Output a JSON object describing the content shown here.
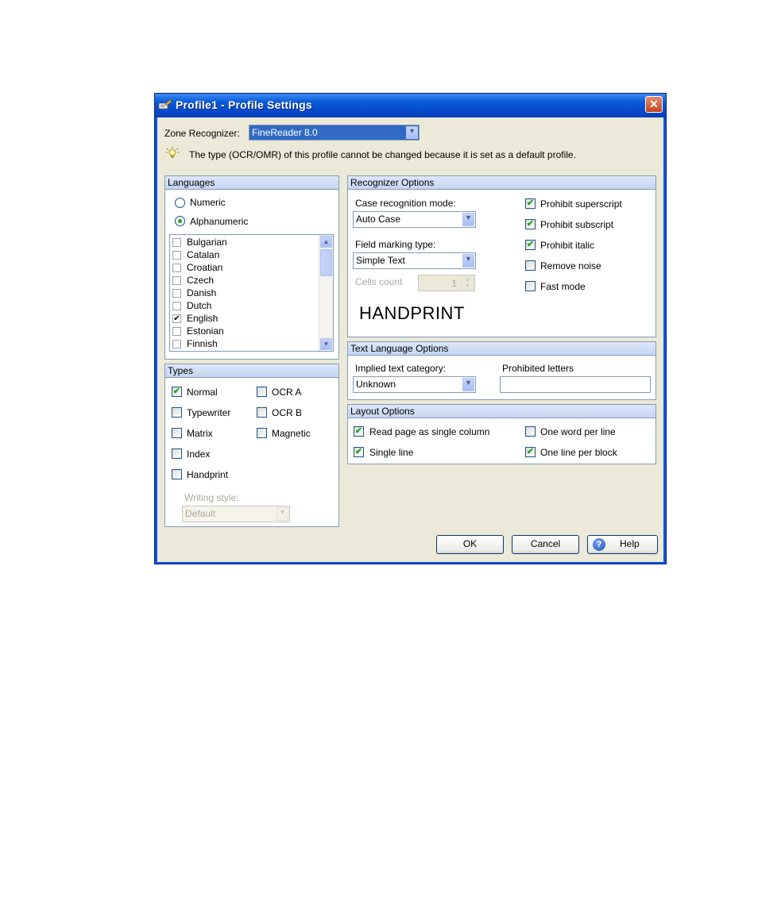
{
  "window": {
    "title": "Profile1 - Profile Settings"
  },
  "zone_recognizer": {
    "label": "Zone Recognizer:",
    "value": "FineReader 8.0"
  },
  "info_message": "The type (OCR/OMR) of this profile cannot be changed because it is set as a default profile.",
  "languages": {
    "header": "Languages",
    "numeric": "Numeric",
    "alphanumeric": "Alphanumeric",
    "items": [
      {
        "label": "Bulgarian",
        "checked": false
      },
      {
        "label": "Catalan",
        "checked": false
      },
      {
        "label": "Croatian",
        "checked": false
      },
      {
        "label": "Czech",
        "checked": false
      },
      {
        "label": "Danish",
        "checked": false
      },
      {
        "label": "Dutch",
        "checked": false
      },
      {
        "label": "English",
        "checked": true
      },
      {
        "label": "Estonian",
        "checked": false
      },
      {
        "label": "Finnish",
        "checked": false
      }
    ]
  },
  "types": {
    "header": "Types",
    "normal": "Normal",
    "typewriter": "Typewriter",
    "matrix": "Matrix",
    "index": "Index",
    "handprint": "Handprint",
    "ocr_a": "OCR A",
    "ocr_b": "OCR B",
    "magnetic": "Magnetic",
    "writing_style_label": "Writing style:",
    "writing_style_value": "Default"
  },
  "recognizer": {
    "header": "Recognizer Options",
    "case_mode_label": "Case recognition mode:",
    "case_mode_value": "Auto Case",
    "field_marking_label": "Field marking type:",
    "field_marking_value": "Simple Text",
    "cells_count_label": "Cells count",
    "cells_count_value": "1",
    "preview_text": "HANDPRINT",
    "prohibit_superscript": "Prohibit superscript",
    "prohibit_subscript": "Prohibit subscript",
    "prohibit_italic": "Prohibit italic",
    "remove_noise": "Remove noise",
    "fast_mode": "Fast mode"
  },
  "text_language": {
    "header": "Text Language Options",
    "implied_label": "Implied text category:",
    "implied_value": "Unknown",
    "prohibited_label": "Prohibited letters",
    "prohibited_value": ""
  },
  "layout": {
    "header": "Layout Options",
    "single_column": "Read page as single column",
    "single_line": "Single line",
    "one_word": "One word per line",
    "one_line_block": "One line per block"
  },
  "buttons": {
    "ok": "OK",
    "cancel": "Cancel",
    "help": "Help"
  }
}
